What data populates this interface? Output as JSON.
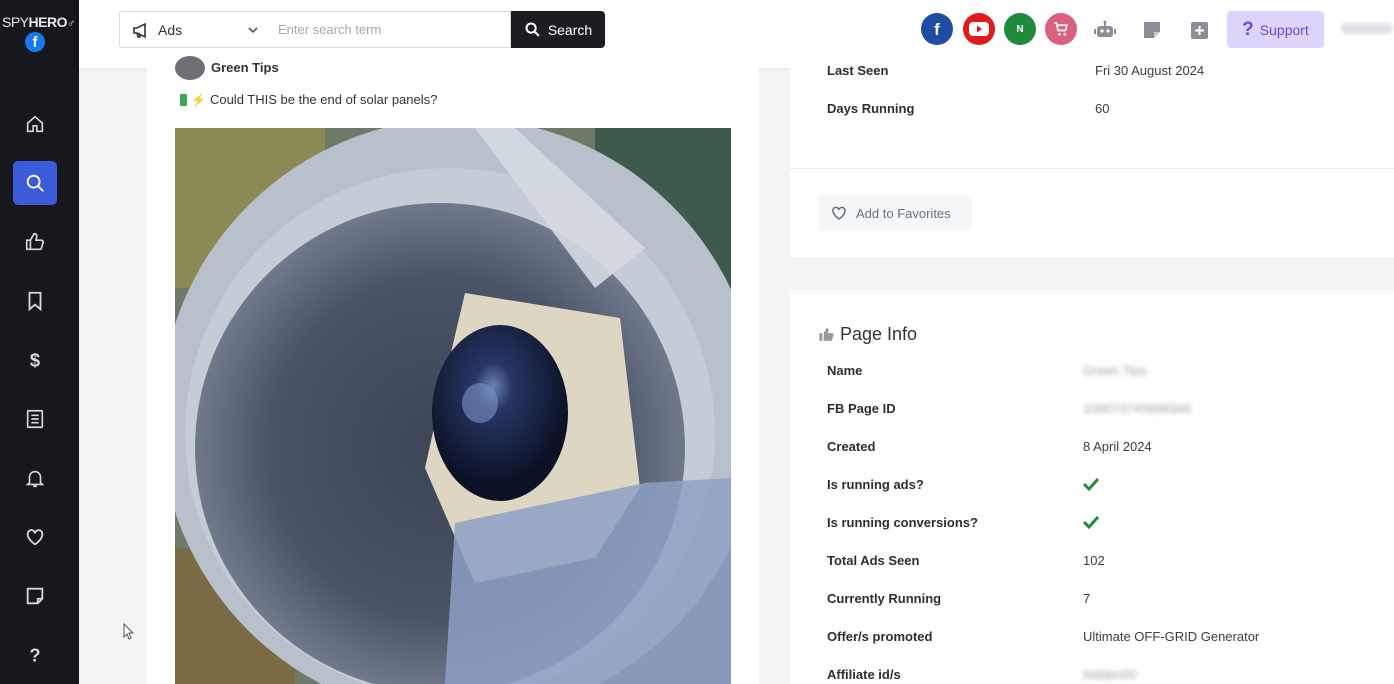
{
  "sidebar": {
    "logo_prefix": "SPY",
    "logo_suffix": "HERO",
    "logo_fb": "f",
    "items": [
      {
        "icon": "home-icon",
        "active": false
      },
      {
        "icon": "search-icon",
        "active": true
      },
      {
        "icon": "thumbs-up-icon",
        "active": false
      },
      {
        "icon": "bookmark-icon",
        "active": false
      },
      {
        "icon": "dollar-icon",
        "active": false
      },
      {
        "icon": "list-icon",
        "active": false
      },
      {
        "icon": "bell-icon",
        "active": false
      },
      {
        "icon": "heart-icon",
        "active": false
      },
      {
        "icon": "note-icon",
        "active": false
      },
      {
        "icon": "help-icon",
        "active": false
      }
    ]
  },
  "topbar": {
    "search_type": "Ads",
    "search_placeholder": "Enter search term",
    "search_button": "Search",
    "social": [
      {
        "icon": "facebook-icon",
        "color": "#1d4ea3"
      },
      {
        "icon": "youtube-icon",
        "color": "#e01b1b"
      },
      {
        "icon": "n-icon",
        "color": "#1f8a3b",
        "letter": "N"
      },
      {
        "icon": "cart-icon",
        "color": "#d9607e"
      }
    ],
    "support_label": "Support"
  },
  "ad": {
    "page_name": "Green Tips",
    "text": "Could THIS be the end of solar panels?"
  },
  "details": {
    "last_seen_label": "Last Seen",
    "last_seen_value": "Fri 30 August 2024",
    "days_running_label": "Days Running",
    "days_running_value": "60",
    "favorites_label": "Add to Favorites"
  },
  "page_info": {
    "title": "Page Info",
    "rows": [
      {
        "label": "Name",
        "value": "Green Tips",
        "blurred": true
      },
      {
        "label": "FB Page ID",
        "value": "100073745698346",
        "blurred": true
      },
      {
        "label": "Created",
        "value": "8 April 2024"
      },
      {
        "label": "Is running ads?",
        "check": true
      },
      {
        "label": "Is running conversions?",
        "check": true
      },
      {
        "label": "Total Ads Seen",
        "value": "102"
      },
      {
        "label": "Currently Running",
        "value": "7"
      },
      {
        "label": "Offer/s promoted",
        "value": "Ultimate OFF-GRID Generator"
      },
      {
        "label": "Affiliate id/s",
        "value": "hidden00",
        "blurred": true
      }
    ]
  },
  "colors": {
    "sidebar_bg": "#16181d",
    "active_nav": "#3b5bdb",
    "check": "#1e8a3a",
    "support_bg": "#ddd5fb",
    "support_fg": "#6a4bd8"
  }
}
